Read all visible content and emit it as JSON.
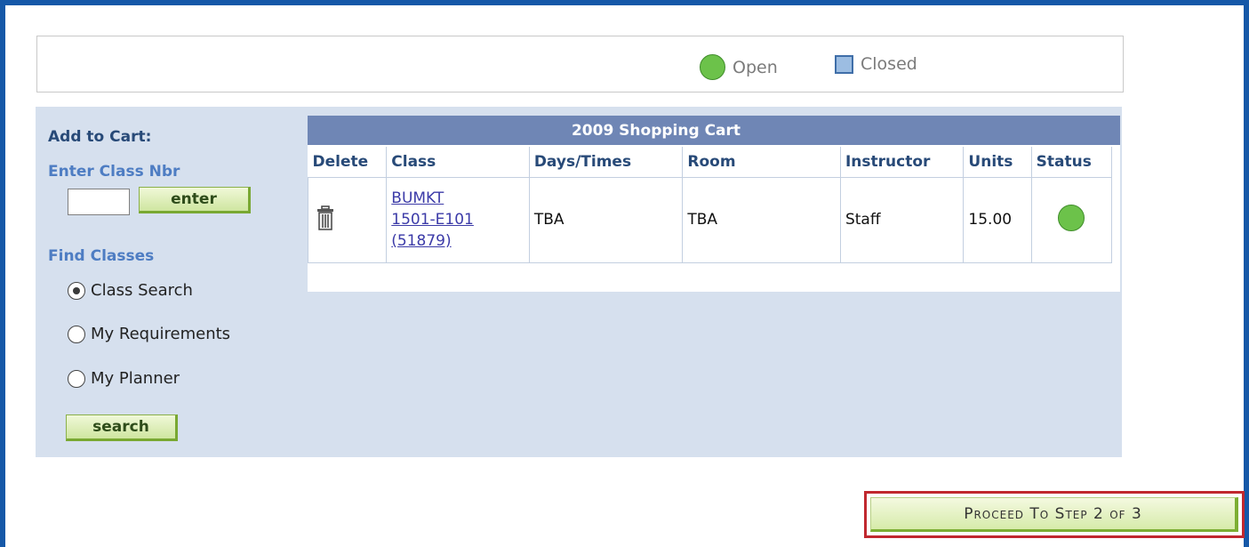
{
  "legend": {
    "open_label": "Open",
    "closed_label": "Closed"
  },
  "add_to_cart": {
    "title": "Add to Cart:",
    "enter_label": "Enter Class Nbr",
    "class_nbr_value": "",
    "enter_button": "enter"
  },
  "find_classes": {
    "title": "Find Classes",
    "options": [
      {
        "label": "Class Search",
        "checked": true
      },
      {
        "label": "My Requirements",
        "checked": false
      },
      {
        "label": "My Planner",
        "checked": false
      }
    ],
    "search_button": "search"
  },
  "cart": {
    "title": "2009 Shopping Cart",
    "columns": [
      "Delete",
      "Class",
      "Days/Times",
      "Room",
      "Instructor",
      "Units",
      "Status"
    ],
    "rows": [
      {
        "class_line1": "BUMKT",
        "class_line2": "1501-E101",
        "class_line3": "(51879)",
        "days_times": "TBA",
        "room": "TBA",
        "instructor": "Staff",
        "units": "15.00",
        "status": "Open"
      }
    ]
  },
  "proceed_button": "Proceed To Step 2 of 3",
  "colors": {
    "frame": "#1558a8",
    "panel": "#d6e0ee",
    "cart_header": "#6f86b5",
    "open_green": "#6cc24a",
    "closed_blue": "#9cbde2",
    "proceed_highlight": "#c0282f"
  }
}
